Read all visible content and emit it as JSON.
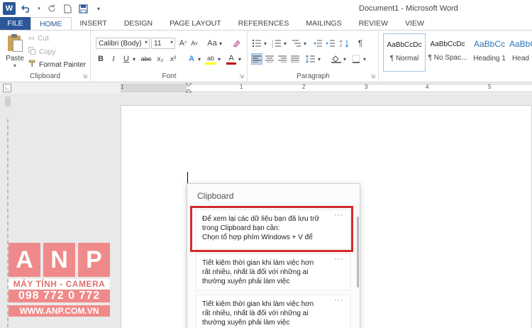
{
  "window": {
    "title": "Document1 - Microsoft Word"
  },
  "qat": {
    "icons": [
      "word-logo",
      "undo-icon",
      "redo-icon",
      "new-document-icon",
      "save-icon",
      "customize-icon"
    ]
  },
  "tabs": [
    {
      "label": "FILE"
    },
    {
      "label": "HOME"
    },
    {
      "label": "INSERT"
    },
    {
      "label": "DESIGN"
    },
    {
      "label": "PAGE LAYOUT"
    },
    {
      "label": "REFERENCES"
    },
    {
      "label": "MAILINGS"
    },
    {
      "label": "REVIEW"
    },
    {
      "label": "VIEW"
    }
  ],
  "ribbon": {
    "clipboard": {
      "paste_label": "Paste",
      "cut_label": "Cut",
      "copy_label": "Copy",
      "format_painter_label": "Format Painter",
      "group_label": "Clipboard"
    },
    "font": {
      "font_name": "Calibri (Body)",
      "font_size": "11",
      "group_label": "Font",
      "grow_label": "A",
      "shrink_label": "A",
      "case_label": "Aa",
      "bold_label": "B",
      "italic_label": "I",
      "underline_label": "U",
      "strike_label": "abc",
      "subscript_label": "x₂",
      "superscript_label": "x²",
      "effects_label": "A",
      "highlight_label": "ab",
      "font_color_label": "A"
    },
    "paragraph": {
      "group_label": "Paragraph",
      "pilcrow": "¶"
    },
    "styles": [
      {
        "sample": "AaBbCcDc",
        "name": "¶ Normal"
      },
      {
        "sample": "AaBbCcDc",
        "name": "¶ No Spac..."
      },
      {
        "sample": "AaBbCc",
        "name": "Heading 1"
      },
      {
        "sample": "AaBbC",
        "name": "Head"
      }
    ]
  },
  "ruler": {
    "numbers": [
      "1",
      "1",
      "2",
      "3",
      "4",
      "5"
    ]
  },
  "clipboard_panel": {
    "title": "Clipboard",
    "more_label": "···",
    "items": [
      {
        "lines": [
          "Để xem lại các dữ liệu bạn đã lưu trữ",
          "trong Clipboard bạn cần:",
          "Chọn tổ hợp phím Windows + V để"
        ]
      },
      {
        "lines": [
          "Tiết kiệm thời gian khi làm việc hơn",
          "rất nhiều, nhất là đối với những ai",
          "thường xuyên phải làm việc"
        ]
      },
      {
        "lines": [
          "Tiết kiệm thời gian khi làm việc hơn",
          "rất nhiều, nhất là đối với những ai",
          "thường xuyên phải làm việc"
        ]
      }
    ]
  },
  "watermark": {
    "letters": [
      "A",
      "N",
      "P"
    ],
    "tagline": "MÁY TÍNH - CAMERA",
    "phone": "098 772 0 772",
    "website": "WWW.ANP.COM.VN"
  },
  "colors": {
    "accent": "#2b579a",
    "highlight_border": "#d32a2a",
    "watermark": "#f08a8a"
  }
}
